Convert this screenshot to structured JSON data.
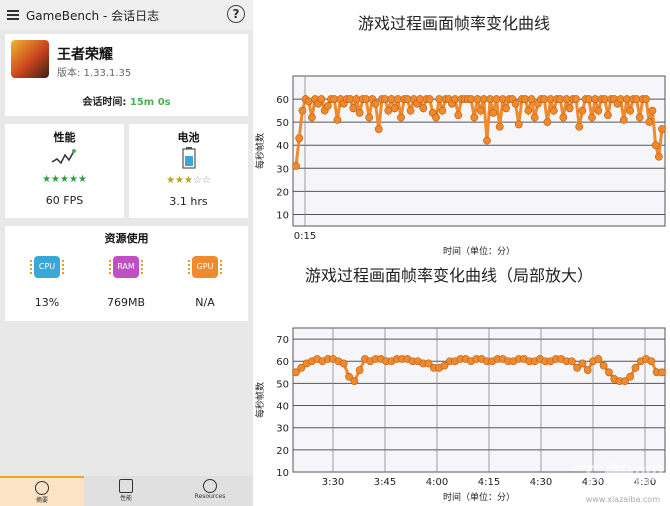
{
  "app": {
    "title": "GameBench - 会话日志",
    "help": "?"
  },
  "game": {
    "name": "王者荣耀",
    "version": "版本: 1.33.1.35",
    "session_label": "会话时间:",
    "session_value": "15m 0s"
  },
  "performance": {
    "title": "性能",
    "stars": 5,
    "value": "60 FPS",
    "star_color": "#2e9e3c"
  },
  "battery": {
    "title": "电池",
    "stars": 3,
    "value": "3.1 hrs",
    "star_color": "#b7a31c"
  },
  "resources": {
    "title": "资源使用",
    "items": [
      {
        "icon": "cpu-chip-icon",
        "label": "CPU",
        "value": "13%",
        "color": "#3aa7d9"
      },
      {
        "icon": "ram-chip-icon",
        "label": "RAM",
        "value": "769MB",
        "color": "#c04fc6"
      },
      {
        "icon": "gpu-chip-icon",
        "label": "GPU",
        "value": "N/A",
        "color": "#f08a2c"
      }
    ]
  },
  "tabs": [
    {
      "label": "摘要",
      "active": true
    },
    {
      "label": "性能",
      "active": false
    },
    {
      "label": "Resources",
      "active": false
    }
  ],
  "chart_data": [
    {
      "type": "line",
      "title": "游戏过程画面帧率变化曲线",
      "xlabel": "时间（单位：分）",
      "ylabel": "每秒帧数",
      "y_ticks": [
        10,
        20,
        30,
        40,
        50,
        60
      ],
      "x_ticks": [
        "0:15"
      ],
      "ylim": [
        5,
        70
      ],
      "grid": true,
      "series": [
        {
          "color": "#f08a2c",
          "values": [
            31,
            43,
            55,
            60,
            59,
            52,
            60,
            58,
            60,
            55,
            57,
            60,
            60,
            51,
            60,
            58,
            60,
            60,
            56,
            60,
            54,
            60,
            60,
            52,
            60,
            58,
            47,
            60,
            60,
            55,
            60,
            56,
            60,
            52,
            60,
            60,
            55,
            60,
            58,
            60,
            56,
            60,
            60,
            54,
            52,
            60,
            55,
            60,
            60,
            58,
            60,
            53,
            60,
            60,
            60,
            60,
            52,
            60,
            55,
            60,
            42,
            60,
            54,
            60,
            48,
            60,
            56,
            60,
            60,
            58,
            49,
            60,
            60,
            55,
            60,
            52,
            58,
            60,
            60,
            50,
            60,
            55,
            60,
            60,
            52,
            60,
            56,
            60,
            60,
            48,
            55,
            60,
            60,
            52,
            60,
            55,
            60,
            60,
            53,
            60,
            60,
            58,
            60,
            51,
            60,
            55,
            60,
            60,
            52,
            60,
            60,
            50,
            55,
            40,
            35,
            47
          ]
        }
      ]
    },
    {
      "type": "line",
      "title": "游戏过程画面帧率变化曲线（局部放大）",
      "xlabel": "时间（单位：分）",
      "ylabel": "每秒帧数",
      "y_ticks": [
        10,
        20,
        30,
        40,
        50,
        60,
        70
      ],
      "x_ticks": [
        "3:30",
        "3:45",
        "4:00",
        "4:15",
        "4:30",
        "4:30",
        "4:30"
      ],
      "ylim": [
        10,
        75
      ],
      "grid": true,
      "series": [
        {
          "color": "#f08a2c",
          "values": [
            55,
            57,
            59,
            60,
            61,
            60,
            61,
            61,
            60,
            59,
            53,
            51,
            56,
            61,
            60,
            61,
            61,
            60,
            60,
            61,
            61,
            61,
            60,
            60,
            59,
            59,
            57,
            57,
            58,
            60,
            60,
            61,
            61,
            60,
            61,
            61,
            60,
            60,
            61,
            61,
            60,
            60,
            61,
            61,
            60,
            60,
            61,
            60,
            60,
            61,
            61,
            60,
            60,
            57,
            59,
            56,
            60,
            61,
            58,
            55,
            52,
            51,
            51,
            53,
            57,
            60,
            61,
            60,
            55,
            55
          ]
        }
      ]
    }
  ],
  "watermark": {
    "brand": "下载吧",
    "url": "www.xiazaiba.com"
  }
}
